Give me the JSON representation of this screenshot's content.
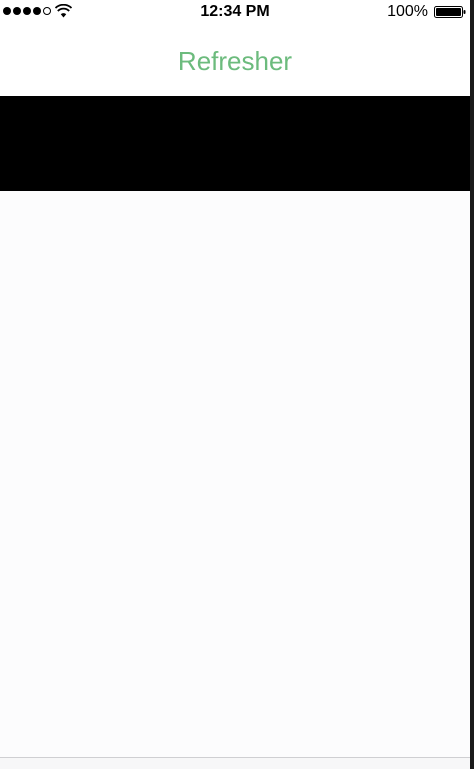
{
  "status_bar": {
    "signal_icon": "signal-dots-icon",
    "wifi_icon": "wifi-icon",
    "time": "12:34 PM",
    "battery_percent": "100%",
    "battery_icon": "battery-full-icon",
    "battery_level": 1.0
  },
  "navbar": {
    "title": "Refresher",
    "title_color": "#6cbb7d"
  },
  "refresher": {
    "background": "#000000"
  }
}
